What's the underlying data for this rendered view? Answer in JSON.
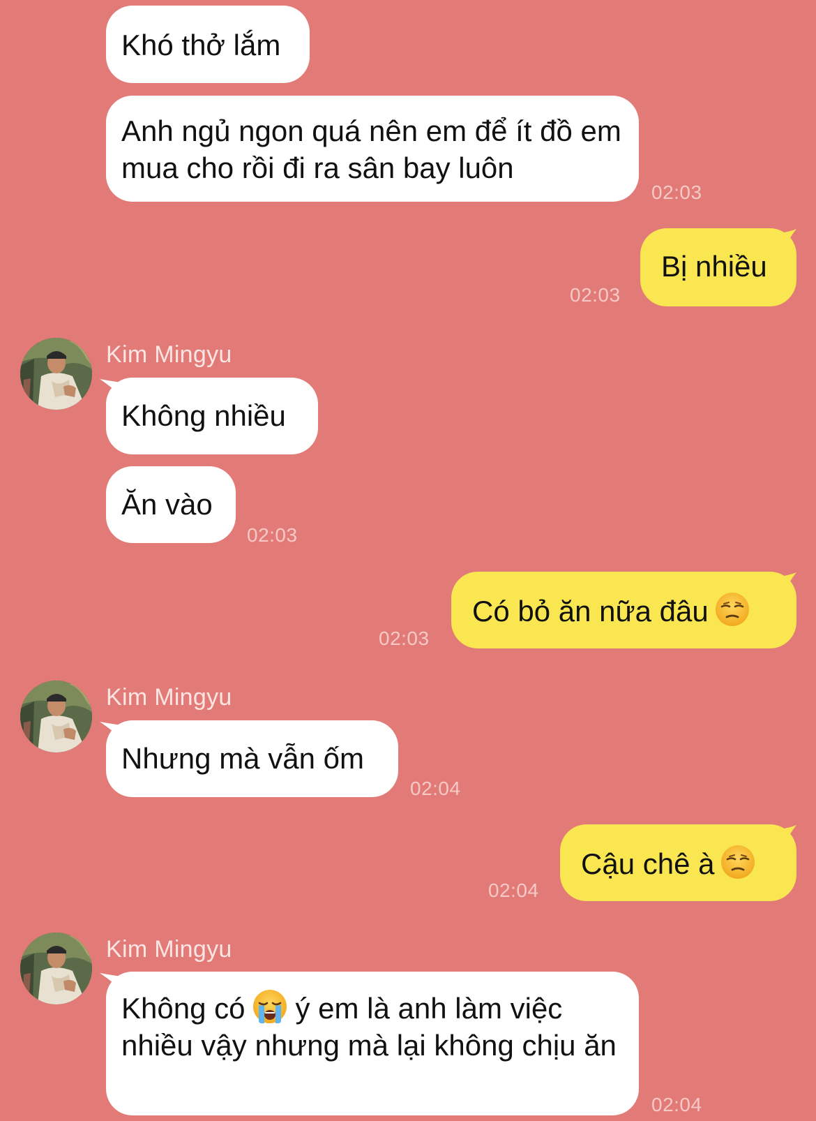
{
  "chat": {
    "contact_name": "Kim Mingyu",
    "messages": [
      {
        "text": "Khó thở lắm"
      },
      {
        "text": "Anh ngủ ngon quá nên em để ít đồ em mua cho rồi đi ra sân bay luôn",
        "time": "02:03"
      },
      {
        "text": "Bị nhiều",
        "time": "02:03"
      },
      {
        "text": "Không nhiều"
      },
      {
        "text": "Ăn vào",
        "time": "02:03"
      },
      {
        "text": "Có bỏ ăn nữa đâu",
        "emoji": "unamused-face-emoji",
        "time": "02:03"
      },
      {
        "text": "Nhưng mà vẫn ốm",
        "time": "02:04"
      },
      {
        "text": "Cậu chê à",
        "emoji": "unamused-face-emoji",
        "time": "02:04"
      },
      {
        "text_before": "Không có",
        "emoji": "loudly-crying-face-emoji",
        "text_after": "ý em là anh làm việc nhiều vậy nhưng mà lại không chịu ăn",
        "time": "02:04"
      }
    ]
  },
  "colors": {
    "background": "#e27b78",
    "incoming_bubble": "#ffffff",
    "outgoing_bubble": "#f9e650",
    "timestamp": "#f6c9c6",
    "sender_name": "#fbe5e3"
  },
  "icons": {
    "avatar": "contact-avatar-photo",
    "unamused": "unamused-face-emoji",
    "crying": "loudly-crying-face-emoji"
  }
}
